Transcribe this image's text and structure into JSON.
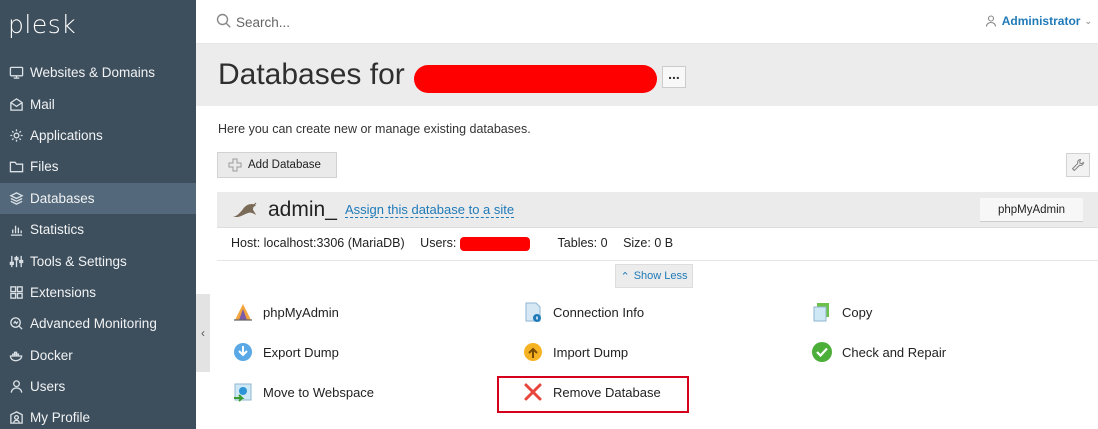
{
  "app": {
    "logo": "plesk"
  },
  "sidebar": {
    "items": [
      {
        "label": "Websites & Domains",
        "icon": "monitor-icon"
      },
      {
        "label": "Mail",
        "icon": "mail-icon"
      },
      {
        "label": "Applications",
        "icon": "gear-icon"
      },
      {
        "label": "Files",
        "icon": "folder-icon"
      },
      {
        "label": "Databases",
        "icon": "layers-icon",
        "active": true
      },
      {
        "label": "Statistics",
        "icon": "bar-chart-icon"
      },
      {
        "label": "Tools & Settings",
        "icon": "sliders-icon"
      },
      {
        "label": "Extensions",
        "icon": "grid-icon"
      },
      {
        "label": "Advanced Monitoring",
        "icon": "monitoring-icon"
      },
      {
        "label": "Docker",
        "icon": "docker-icon"
      },
      {
        "label": "Users",
        "icon": "user-icon"
      },
      {
        "label": "My Profile",
        "icon": "profile-icon"
      }
    ]
  },
  "topbar": {
    "search_placeholder": "Search...",
    "user": "Administrator"
  },
  "page": {
    "title": "Databases for",
    "more_label": "...",
    "intro": "Here you can create new or manage existing databases.",
    "add_database": "Add Database"
  },
  "database": {
    "name": "admin_",
    "assign_link": "Assign this database to a site",
    "phpmyadmin_button": "phpMyAdmin",
    "host": "Host: localhost:3306 (MariaDB)",
    "users_label": "Users:",
    "tables": "Tables: 0",
    "size": "Size: 0 B",
    "show_less": "Show Less",
    "actions": [
      {
        "label": "phpMyAdmin",
        "icon": "phpmyadmin-icon"
      },
      {
        "label": "Connection Info",
        "icon": "connection-info-icon"
      },
      {
        "label": "Copy",
        "icon": "copy-icon"
      },
      {
        "label": "Export Dump",
        "icon": "export-dump-icon"
      },
      {
        "label": "Import Dump",
        "icon": "import-dump-icon"
      },
      {
        "label": "Check and Repair",
        "icon": "check-icon"
      },
      {
        "label": "Move to Webspace",
        "icon": "move-webspace-icon"
      },
      {
        "label": "Remove Database",
        "icon": "remove-icon"
      }
    ]
  },
  "colors": {
    "sidebar_bg": "#3d4e5c",
    "sidebar_active": "#53687a",
    "link": "#1f7ab8",
    "redaction": "#ff0000",
    "highlight_border": "#d5001c"
  }
}
